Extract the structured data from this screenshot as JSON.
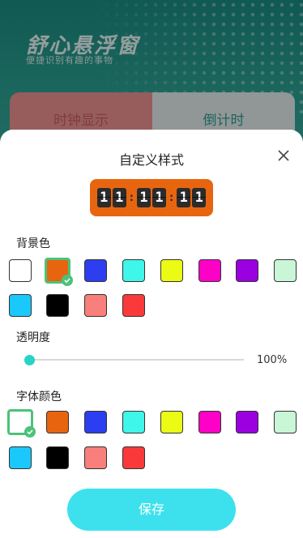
{
  "app": {
    "title": "舒心悬浮窗",
    "subtitle": "便捷识别有趣的事物",
    "tabs": [
      "时钟显示",
      "倒计时"
    ]
  },
  "sheet": {
    "title": "自定义样式",
    "close_icon": "close-icon"
  },
  "clock_preview": {
    "digits": [
      "1",
      "1",
      "1",
      "1",
      "1",
      "1"
    ],
    "separator": ":",
    "background": "#e8650f"
  },
  "background_color": {
    "label": "背景色",
    "options": [
      "#ffffff",
      "#e8650f",
      "#2d3ef0",
      "#3ff6ea",
      "#ecfb14",
      "#ff00c7",
      "#9a00e0",
      "#c9f6d7",
      "#1ac8fc",
      "#000000",
      "#f87f7b",
      "#fa3a3a"
    ],
    "selected_index": 1
  },
  "opacity": {
    "label": "透明度",
    "value_text": "100%",
    "value_fraction": 1.0
  },
  "font_color": {
    "label": "字体颜色",
    "options": [
      "#ffffff",
      "#e8650f",
      "#2d3ef0",
      "#3ff6ea",
      "#ecfb14",
      "#ff00c7",
      "#9a00e0",
      "#c9f6d7",
      "#1ac8fc",
      "#000000",
      "#f87f7b",
      "#fa3a3a"
    ],
    "selected_index": 0
  },
  "actions": {
    "save_label": "保存"
  },
  "colors": {
    "accent": "#4cc27a",
    "save_button": "#3de1ee",
    "slider_thumb": "#28d3c6"
  }
}
